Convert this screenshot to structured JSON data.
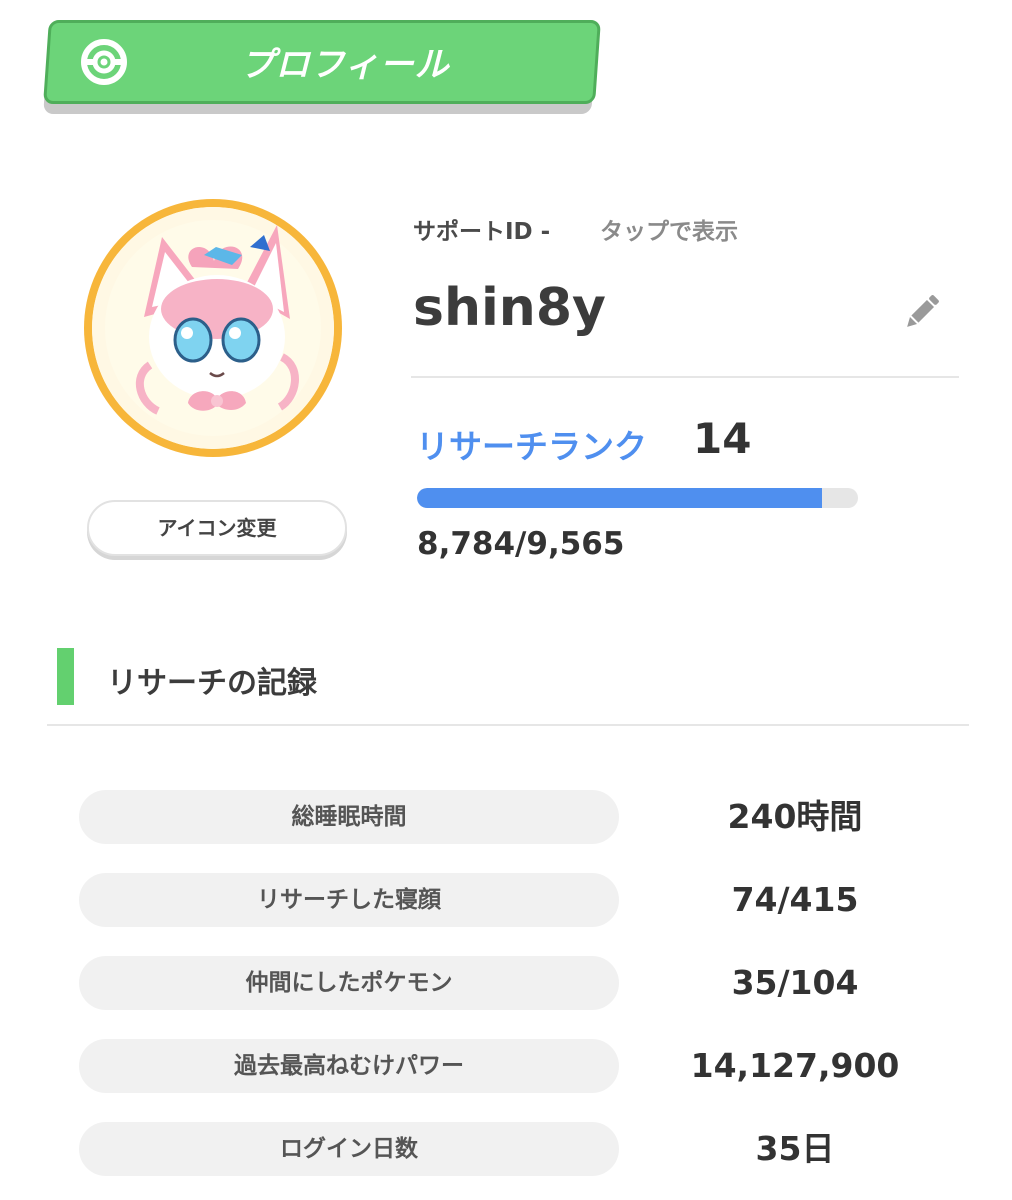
{
  "header": {
    "title": "プロフィール",
    "icon": "pokeball-icon",
    "color": "#6cd479"
  },
  "avatar": {
    "icon": "sylveon-avatar",
    "change_button_label": "アイコン変更"
  },
  "profile": {
    "support_id_label": "サポートID -",
    "support_id_action": "タップで表示",
    "username": "shin8y",
    "edit_icon": "pencil-icon",
    "rank_label": "リサーチランク",
    "rank_value": "14",
    "rank_color": "#4f8fef",
    "progress_text": "8,784/9,565",
    "progress_current": 8784,
    "progress_max": 9565
  },
  "records": {
    "title": "リサーチの記録",
    "accent_color": "#63d06f",
    "stats": [
      {
        "label": "総睡眠時間",
        "value": "240時間"
      },
      {
        "label": "リサーチした寝顔",
        "value": "74/415"
      },
      {
        "label": "仲間にしたポケモン",
        "value": "35/104"
      },
      {
        "label": "過去最高ねむけパワー",
        "value": "14,127,900"
      },
      {
        "label": "ログイン日数",
        "value": "35日"
      }
    ]
  }
}
